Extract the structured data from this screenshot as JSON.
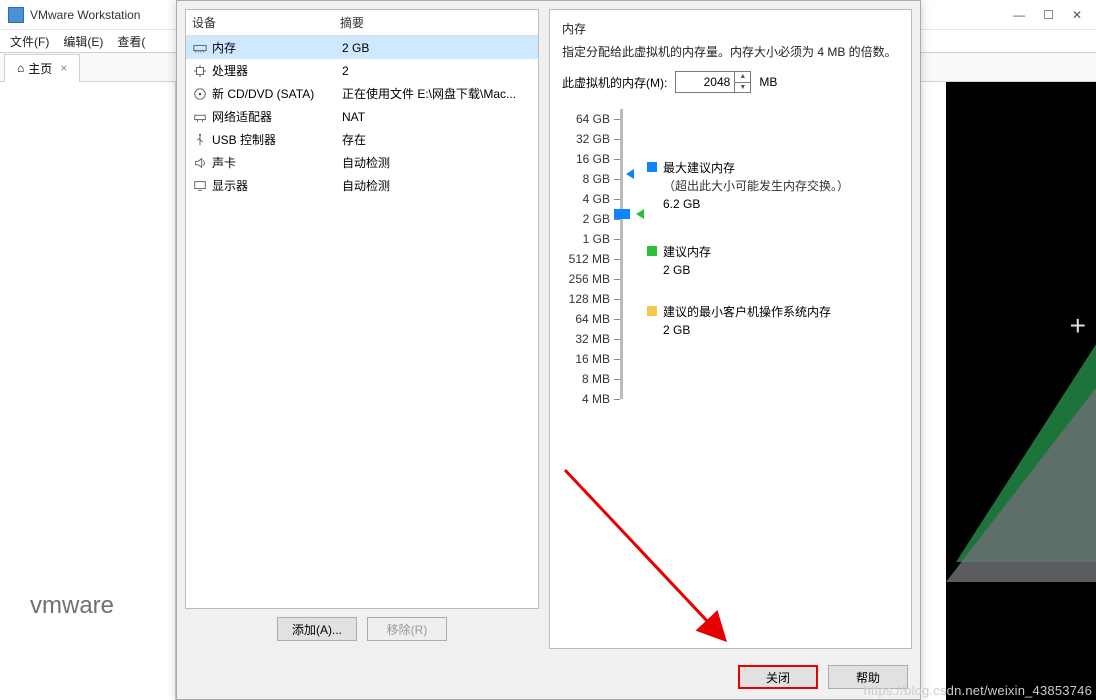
{
  "bg": {
    "app_title": "VMware Workstation",
    "menu": {
      "file": "文件(F)",
      "edit": "编辑(E)",
      "view": "查看("
    },
    "tab": {
      "home": "主页"
    },
    "logo": "vmware"
  },
  "device_panel": {
    "header_device": "设备",
    "header_summary": "摘要",
    "rows": [
      {
        "name": "内存",
        "summary": "2 GB",
        "icon": "memory"
      },
      {
        "name": "处理器",
        "summary": "2",
        "icon": "cpu"
      },
      {
        "name": "新 CD/DVD (SATA)",
        "summary": "正在使用文件 E:\\网盘下载\\Mac...",
        "icon": "disc"
      },
      {
        "name": "网络适配器",
        "summary": "NAT",
        "icon": "network"
      },
      {
        "name": "USB 控制器",
        "summary": "存在",
        "icon": "usb"
      },
      {
        "name": "声卡",
        "summary": "自动检测",
        "icon": "sound"
      },
      {
        "name": "显示器",
        "summary": "自动检测",
        "icon": "display"
      }
    ],
    "btn_add": "添加(A)...",
    "btn_remove": "移除(R)"
  },
  "memory_panel": {
    "title": "内存",
    "desc": "指定分配给此虚拟机的内存量。内存大小必须为 4 MB 的倍数。",
    "input_label": "此虚拟机的内存(M):",
    "input_value": "2048",
    "unit": "MB",
    "ticks": [
      "64 GB",
      "32 GB",
      "16 GB",
      "8 GB",
      "4 GB",
      "2 GB",
      "1 GB",
      "512 MB",
      "256 MB",
      "128 MB",
      "64 MB",
      "32 MB",
      "16 MB",
      "8 MB",
      "4 MB"
    ],
    "legend": {
      "max": {
        "label": "最大建议内存",
        "note": "（超出此大小可能发生内存交换。）",
        "val": "6.2 GB"
      },
      "rec": {
        "label": "建议内存",
        "val": "2 GB"
      },
      "min": {
        "label": "建议的最小客户机操作系统内存",
        "val": "2 GB"
      }
    }
  },
  "footer": {
    "close": "关闭",
    "help": "帮助"
  },
  "watermark": "https://blog.csdn.net/weixin_43853746"
}
